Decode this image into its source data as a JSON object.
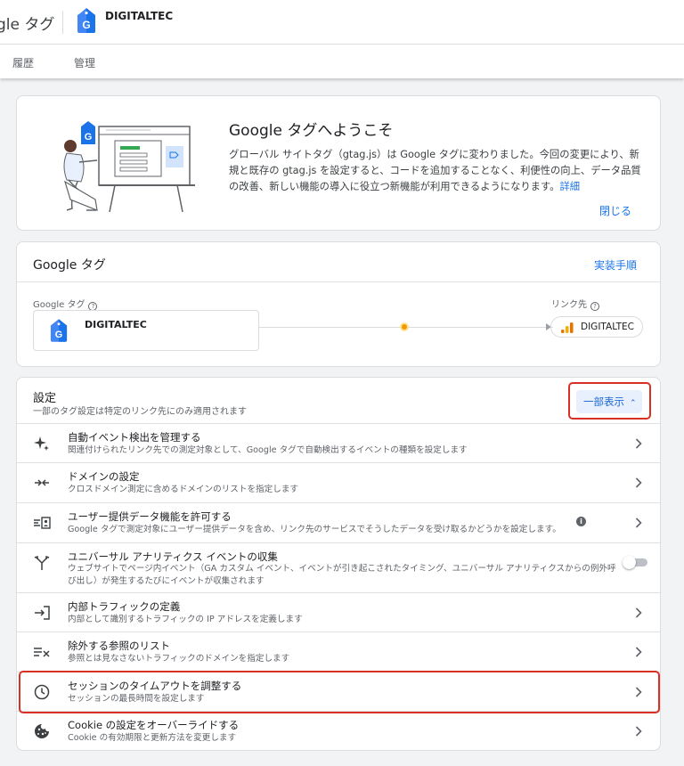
{
  "header": {
    "app_title": "gle タグ",
    "container_name": "DIGITALTEC"
  },
  "tabs": [
    {
      "label": "履歴"
    },
    {
      "label": "管理"
    }
  ],
  "welcome": {
    "title": "Google タグへようこそ",
    "body": "グローバル サイトタグ（gtag.js）は Google タグに変わりました。今回の変更により、新規と既存の gtag.js を設定すると、コードを追加することなく、利便性の向上、データ品質の改善、新しい機能の導入に役立つ新機能が利用できるようになります。",
    "learn_more": "詳細",
    "close": "閉じる"
  },
  "google_tag": {
    "title": "Google タグ",
    "setup_link": "実装手順",
    "tag_label": "Google タグ",
    "tag_name": "DIGITALTEC",
    "dest_label": "リンク先",
    "dest_name": "DIGITALTEC"
  },
  "settings": {
    "title": "設定",
    "subtitle": "一部のタグ設定は特定のリンク先にのみ適用されます",
    "partial_button": "一部表示",
    "rows": [
      {
        "title": "自動イベント検出を管理する",
        "desc": "関連付けられたリンク先での測定対象として、Google タグで自動検出するイベントの種類を設定します"
      },
      {
        "title": "ドメインの設定",
        "desc": "クロスドメイン測定に含めるドメインのリストを指定します"
      },
      {
        "title": "ユーザー提供データ機能を許可する",
        "desc": "Google タグで測定対象にユーザー提供データを含め、リンク先のサービスでそうしたデータを受け取るかどうかを設定します。"
      },
      {
        "title": "ユニバーサル アナリティクス イベントの収集",
        "desc": "ウェブサイトでページ内イベント（GA カスタム イベント、イベントが引き起こされたタイミング、ユニバーサル アナリティクスからの例外呼び出し）が発生するたびにイベントが収集されます"
      },
      {
        "title": "内部トラフィックの定義",
        "desc": "内部として識別するトラフィックの IP アドレスを定義します"
      },
      {
        "title": "除外する参照のリスト",
        "desc": "参照とは見なさないトラフィックのドメインを指定します"
      },
      {
        "title": "セッションのタイムアウトを調整する",
        "desc": "セッションの最長時間を設定します"
      },
      {
        "title": "Cookie の設定をオーバーライドする",
        "desc": "Cookie の有効期限と更新方法を変更します"
      }
    ]
  },
  "colors": {
    "accent": "#1a73e8",
    "highlight": "#d93025",
    "warning_dot": "#f29900"
  }
}
